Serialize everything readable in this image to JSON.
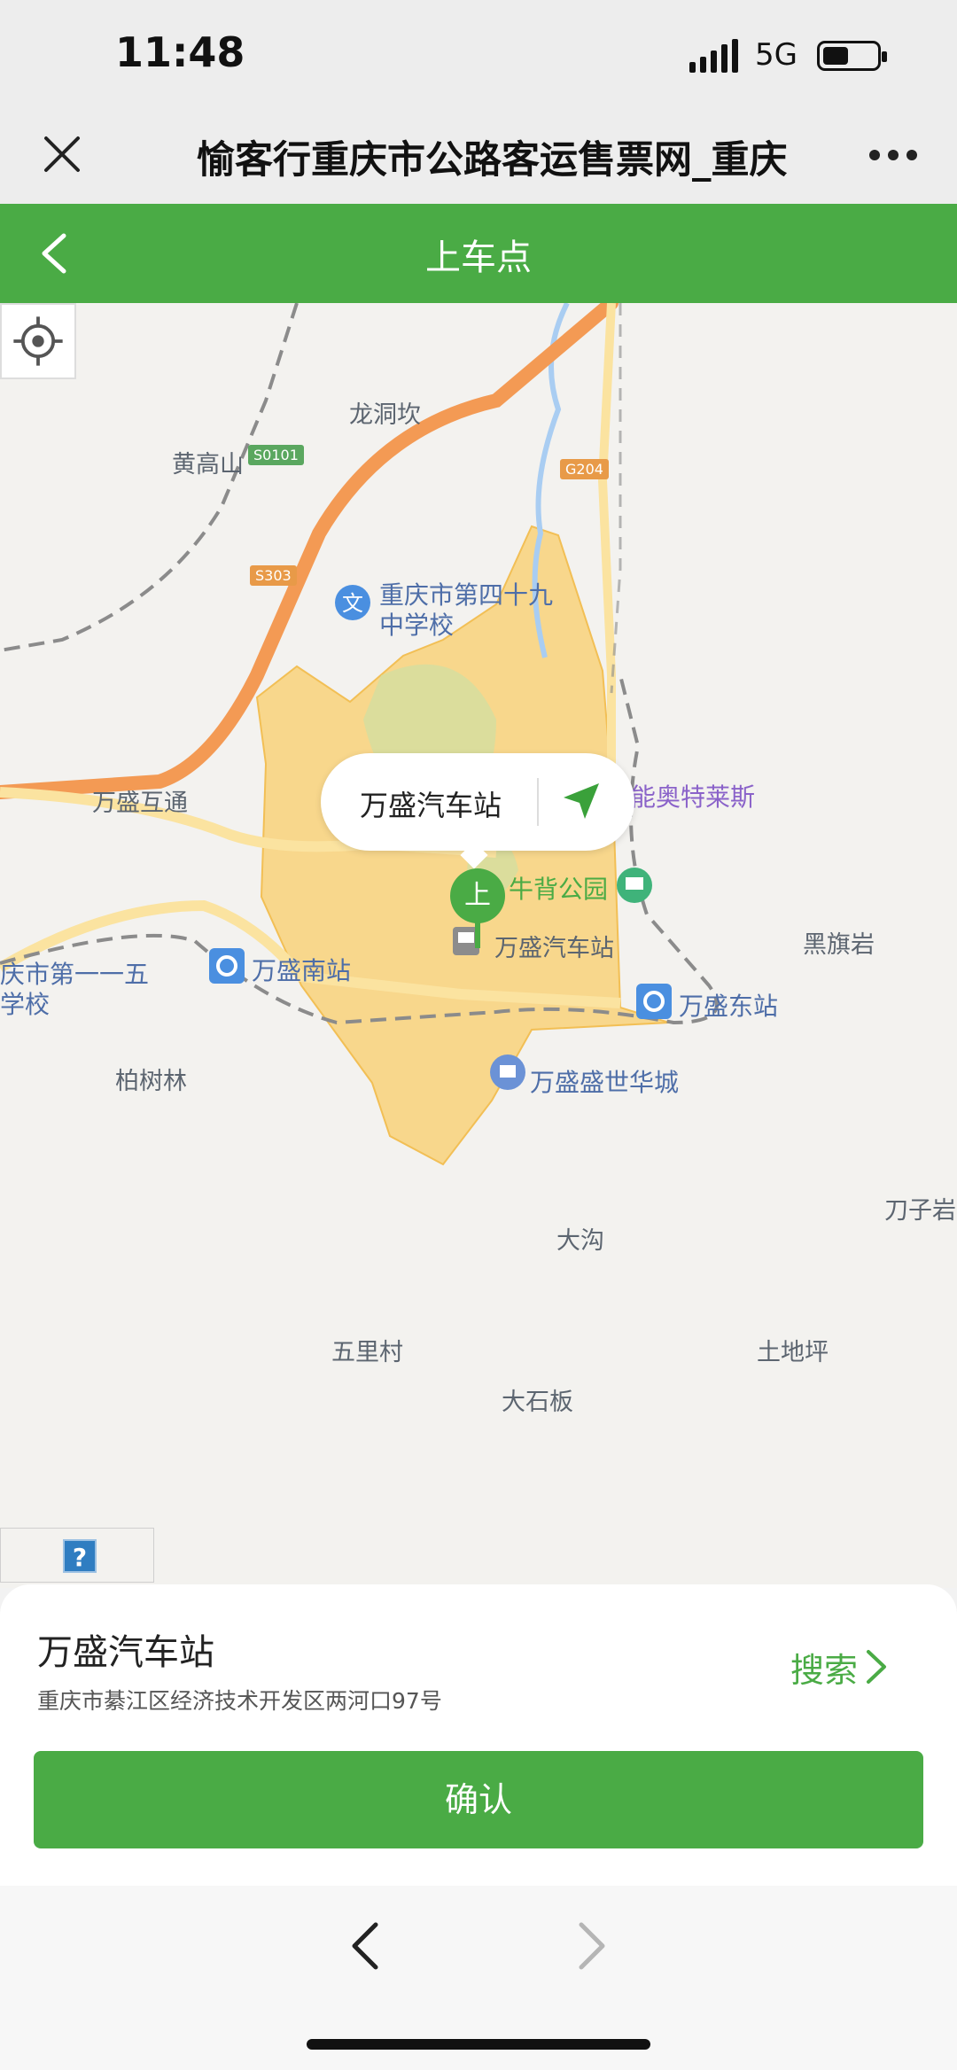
{
  "status": {
    "time": "11:48",
    "network": "5G"
  },
  "titlebar": {
    "title": "愉客行重庆市公路客运售票网_重庆",
    "close_icon": "close-icon",
    "more_icon": "more-icon"
  },
  "header": {
    "title": "上车点",
    "back_icon": "back-arrow-icon"
  },
  "map": {
    "places": {
      "longdongkan": "龙洞坎",
      "huanggaoshan": "黄高山",
      "school49": "重庆市第四十九",
      "school49b": "中学校",
      "wanshenghutong": "万盛互通",
      "outlets": "能奥特莱斯",
      "niubei_park": "牛背公园",
      "wansheng_bus": "万盛汽车站",
      "heiqiyan": "黑旗岩",
      "wansheng_south": "万盛南站",
      "school115a": "庆市第一一五",
      "school115b": "学校",
      "wansheng_east": "万盛东站",
      "baishulin": "柏树林",
      "shengshihuacheng": "万盛盛世华城",
      "daozyan": "刀子岩",
      "dagou": "大沟",
      "wulicun": "五里村",
      "tudiping": "土地坪",
      "dashiban": "大石板"
    },
    "road_labels": {
      "s0101": "S0101",
      "g204": "G204",
      "s303": "S303"
    },
    "bubble": {
      "name": "万盛汽车站"
    },
    "pin_label": "上",
    "help": "?",
    "colors": {
      "district_fill": "#f8d27a",
      "highway": "#f39a54",
      "river": "#a9cdf2"
    }
  },
  "panel": {
    "station_name": "万盛汽车站",
    "address": "重庆市綦江区经济技术开发区两河口97号",
    "search_label": "搜索",
    "confirm_label": "确认"
  },
  "colors": {
    "brand": "#4aab45"
  }
}
